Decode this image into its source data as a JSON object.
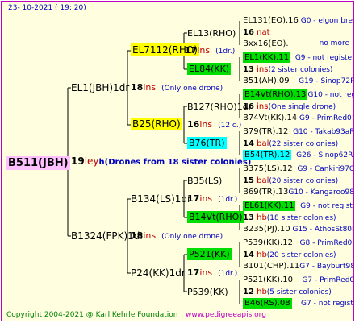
{
  "date": "23- 10-2021 ( 19: 20)",
  "copyright": "Copyright 2004-2021 @ Karl Kehrle Foundation",
  "site": "www.pedigreeapis.org",
  "root": {
    "name": "B511(JBH)",
    "gen": "19",
    "suffix": "ley",
    "note": "h(Drones from 18 sister colonies)"
  },
  "g1": [
    {
      "name": "EL1(JBH)1dr",
      "gen": "18",
      "suffix": "ins",
      "note": "(Only one drone)"
    },
    {
      "name": "B1324(FPK)1dr",
      "gen": "18",
      "suffix": "ins",
      "note": "(Only one drone)"
    }
  ],
  "g2": [
    {
      "name": "EL7112(RHO)",
      "gen": "17",
      "suffix": "ins",
      "note": "(1dr.)"
    },
    {
      "name": "B25(RHO)",
      "gen": "16",
      "suffix": "ins",
      "note": "(12 c.)"
    },
    {
      "name": "B134(LS)1dr",
      "gen": "17",
      "suffix": "ins",
      "note": "(1dr.)"
    },
    {
      "name": "P24(KK)1dr",
      "gen": "17",
      "suffix": "ins",
      "note": "(1dr.)"
    }
  ],
  "g3": [
    {
      "name": "EL13(RHO)"
    },
    {
      "name": "EL84(KK)"
    },
    {
      "name": "B127(RHO)1dr",
      "gen": "16",
      "suffix": "ins",
      "note": "(One single drone)"
    },
    {
      "name": "B76(TR)",
      "gen": "14",
      "suffix": "bal",
      "note": "(22 sister colonies)"
    },
    {
      "name": "B35(LS)"
    },
    {
      "name": "B14Vt(RHO)"
    },
    {
      "name": "P521(KK)"
    },
    {
      "name": "P539(KK)"
    }
  ],
  "g4": [
    {
      "name": "EL131(EO).16",
      "ann": "G0 - elgon breed"
    },
    {
      "name": "",
      "gen": "16",
      "suffix": "nat"
    },
    {
      "name": "Bxx16(EO).",
      "ann": "no more"
    },
    {
      "name": "EL1(KK).11",
      "ann": "G9 - not registe"
    },
    {
      "name": "",
      "gen": "13",
      "suffix": "ins",
      "note": "(2 sister colonies)"
    },
    {
      "name": "B51(AH).09",
      "ann": "G19 - Sinop72R"
    },
    {
      "name": "B14Vt(RHO).13",
      "ann": "G10 - not registe"
    },
    {
      "name": "",
      "gen": "16",
      "suffix": "ins",
      "note": "(One single drone)"
    },
    {
      "name": "B74Vt(KK).14",
      "ann": "G9 - PrimRed01"
    },
    {
      "name": "B79(TR).12",
      "ann": "G10 - Takab93aR"
    },
    {
      "name": "",
      "gen": "14",
      "suffix": "bal",
      "note": "(22 sister colonies)"
    },
    {
      "name": "B54(TR).12",
      "ann": "G26 - Sinop62R"
    },
    {
      "name": "B375(LS).12",
      "ann": "G9 - Cankiri97Q"
    },
    {
      "name": "",
      "gen": "15",
      "suffix": "bal",
      "note": "(20 sister colonies)"
    },
    {
      "name": "B69(TR).13",
      "ann": "G10 - Kangaroo98R"
    },
    {
      "name": "EL61(KK).11",
      "ann": "G9 - not registe"
    },
    {
      "name": "",
      "gen": "13",
      "suffix": "hb",
      "note": "(18 sister colonies)"
    },
    {
      "name": "B235(PJ).10",
      "ann": "G15 - AthosSt80R"
    },
    {
      "name": "P539(KK).12",
      "ann": "G8 - PrimRed01"
    },
    {
      "name": "",
      "gen": "14",
      "suffix": "hb",
      "note": "(20 sister colonies)"
    },
    {
      "name": "B101(CHP).11",
      "ann": "G7 - Bayburt98-3"
    },
    {
      "name": "P521(KK).10",
      "ann": "G7 - PrimRed01"
    },
    {
      "name": "",
      "gen": "12",
      "suffix": "hb",
      "note": "(5 sister colonies)"
    },
    {
      "name": "B46(RS).08",
      "ann": "G7 - not registe"
    }
  ]
}
